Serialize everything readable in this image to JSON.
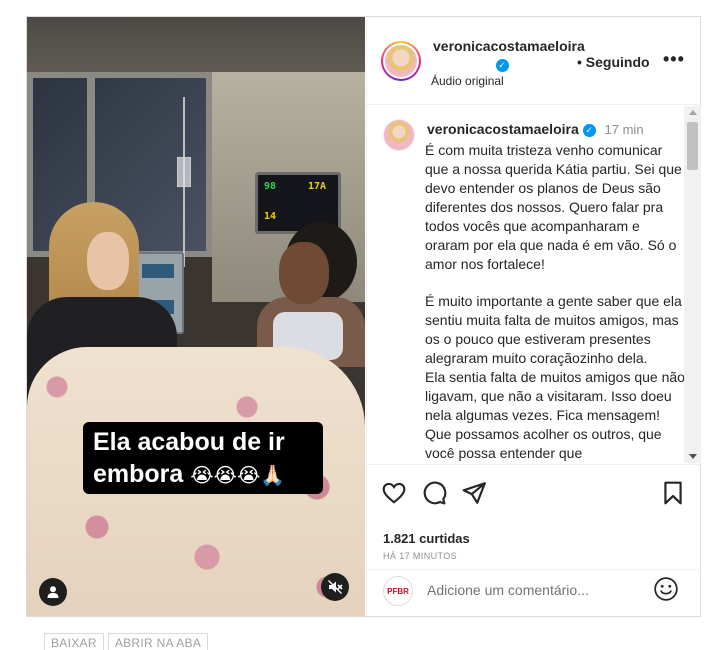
{
  "post": {
    "media": {
      "caption_line1": "Ela acabou de ir",
      "caption_line2": "embora",
      "caption_emojis": "😭😭😭🙏🏻",
      "monitor_readings": [
        "98",
        "17A",
        "14"
      ],
      "tag_icon": "person-icon",
      "mute_icon": "speaker-muted-icon"
    },
    "header": {
      "username": "veronicacostamaeloira",
      "separator": "•",
      "follow_label": "Seguindo",
      "audio_label": "Áudio original",
      "more_label": "•••"
    },
    "comment": {
      "username": "veronicacostamaeloira",
      "time": "17 min",
      "paragraphs": [
        "É com muita tristeza venho comunicar que a nossa querida Kátia partiu. Sei que devo entender os planos de Deus são diferentes dos nossos. Quero falar pra todos vocês que acompanharam e oraram por ela que nada é em vão. Só o amor nos fortalece!",
        "É muito importante a gente saber que ela sentiu muita falta de muitos amigos, mas os o pouco que estiveram presentes alegraram muito coraçãozinho dela.",
        "Ela sentia falta de muitos amigos que não ligavam, que não a visitaram. Isso doeu nela algumas vezes. Fica mensagem! Que possamos acolher os outros, que você possa entender que"
      ]
    },
    "actions": {
      "like_icon": "heart-icon",
      "comment_icon": "comment-icon",
      "share_icon": "paper-plane-icon",
      "save_icon": "bookmark-icon",
      "likes_text": "1.821 curtidas",
      "time_ago": "HÁ 17 MINUTOS"
    },
    "add_comment": {
      "avatar_text": "PFBR",
      "placeholder": "Adicione um comentário...",
      "emoji_icon": "smiley-icon"
    }
  },
  "bottom_links": {
    "download": "BAIXAR",
    "open_tab": "ABRIR NA ABA"
  },
  "colors": {
    "verified_blue": "#0095f6",
    "text": "#262626",
    "muted": "#8e8e8e",
    "border": "#dbdbdb"
  }
}
